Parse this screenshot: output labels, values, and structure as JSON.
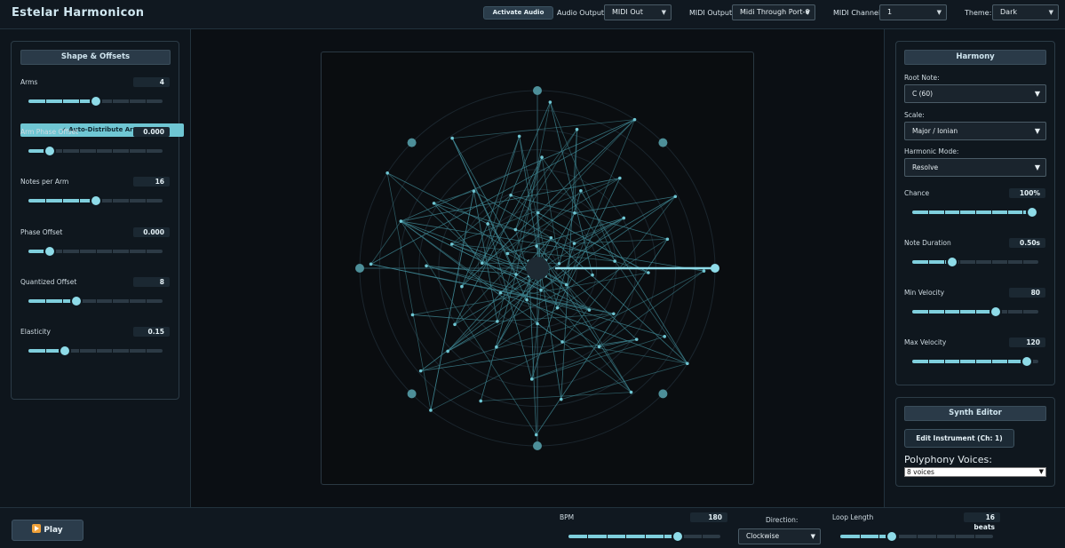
{
  "header": {
    "title": "Estelar Harmonicon",
    "activate_audio": "Activate Audio",
    "audio_output_label": "Audio Output:",
    "audio_output_value": "MIDI Out",
    "midi_output_label": "MIDI Output:",
    "midi_output_value": "Midi Through Port-0",
    "midi_channel_label": "MIDI Channel:",
    "midi_channel_value": "1",
    "theme_label": "Theme:",
    "theme_value": "Dark"
  },
  "left_panel": {
    "title": "Shape & Offsets",
    "auto_distribute": "✓ Auto-Distribute Arms",
    "params": [
      {
        "label": "Arms",
        "value": "4",
        "level": 0.5
      },
      {
        "label": "Arm Phase Offset",
        "value": "0.000",
        "level": 0.16
      },
      {
        "label": "Notes per Arm",
        "value": "16",
        "level": 0.5
      },
      {
        "label": "Phase Offset",
        "value": "0.000",
        "level": 0.16
      },
      {
        "label": "Quantized Offset",
        "value": "8",
        "level": 0.36
      },
      {
        "label": "Elasticity",
        "value": "0.15",
        "level": 0.27
      }
    ]
  },
  "harmony": {
    "title": "Harmony",
    "root_note_label": "Root Note:",
    "root_note_value": "C (60)",
    "scale_label": "Scale:",
    "scale_value": "Major / Ionian",
    "mode_label": "Harmonic Mode:",
    "mode_value": "Resolve",
    "params": [
      {
        "label": "Chance",
        "value": "100%",
        "level": 0.95
      },
      {
        "label": "Note Duration",
        "value": "0.50s",
        "level": 0.32
      },
      {
        "label": "Min Velocity",
        "value": "80",
        "level": 0.66
      },
      {
        "label": "Max Velocity",
        "value": "120",
        "level": 0.91
      }
    ]
  },
  "synth": {
    "title": "Synth Editor",
    "edit_button": "Edit Instrument (Ch: 1)",
    "polyphony_label": "Polyphony Voices:",
    "polyphony_value": "8 voices"
  },
  "bottom": {
    "play": "Play",
    "bpm_label": "BPM",
    "bpm_value": "180",
    "bpm_level": 0.72,
    "direction_label": "Direction:",
    "direction_value": "Clockwise",
    "loop_label": "Loop Length",
    "loop_value": "16 beats",
    "loop_level": 0.34
  },
  "colors": {
    "accent": "#7fcfdd",
    "background": "#0b0f14",
    "panel": "#0f171e"
  }
}
